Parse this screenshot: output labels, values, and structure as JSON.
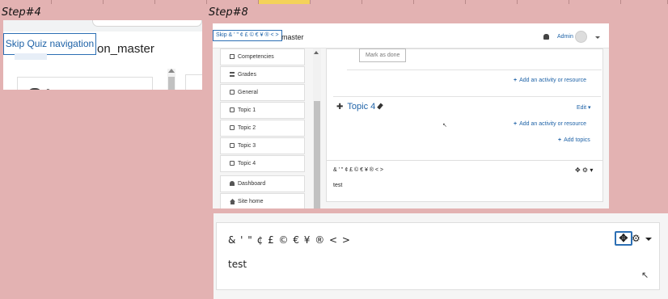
{
  "sheet": {
    "selected_column_index": 5
  },
  "labels": {
    "step4": "Step#4",
    "step8": "Step#8"
  },
  "step4": {
    "skip_link": "Skip Quiz navigation",
    "partial_title": "on_master",
    "partial_letter": "c"
  },
  "step8": {
    "skip_link": "Skip & ' \" ¢ £ © € ¥ ® < >",
    "partial_title": "master",
    "user_name": "Admin",
    "drawer": [
      {
        "label": "Competencies",
        "icon": "check-icon"
      },
      {
        "label": "Grades",
        "icon": "table-icon"
      },
      {
        "label": "General",
        "icon": "folder-icon"
      },
      {
        "label": "Topic 1",
        "icon": "folder-icon"
      },
      {
        "label": "Topic 2",
        "icon": "folder-icon"
      },
      {
        "label": "Topic 3",
        "icon": "folder-icon"
      },
      {
        "label": "Topic 4",
        "icon": "folder-icon"
      },
      {
        "label": "Dashboard",
        "icon": "dashboard-icon"
      },
      {
        "label": "Site home",
        "icon": "home-icon"
      }
    ],
    "mark_as_done": "Mark as done",
    "add_activity_1": "Add an activity or resource",
    "topic_title": "Topic 4",
    "edit": "Edit",
    "add_activity_2": "Add an activity or resource",
    "add_topics": "Add topics",
    "block_title": "& ' \" ¢ £ © € ¥ ® < >",
    "block_text": "test"
  },
  "zoom": {
    "block_title": "& ' \" ¢ £ © € ¥ ® < >",
    "block_text": "test"
  }
}
